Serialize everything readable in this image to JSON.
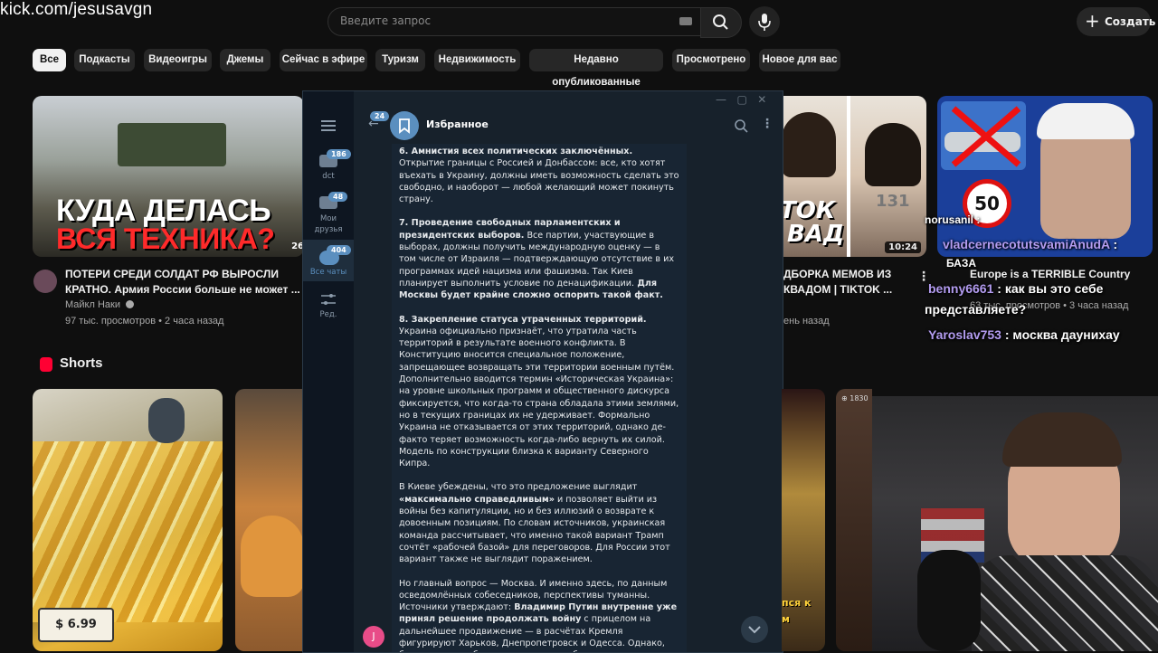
{
  "watermark": "kick.com/jesusavgn",
  "search": {
    "placeholder": "Введите запрос"
  },
  "header": {
    "create_label": "Создать",
    "plus": "+"
  },
  "chips": [
    "Все",
    "Подкасты",
    "Видеоигры",
    "Джемы",
    "Сейчас в эфире",
    "Туризм",
    "Недвижимость",
    "Недавно опубликованные",
    "Просмотрено",
    "Новое для вас"
  ],
  "video1": {
    "thumb_line1": "КУДА ДЕЛАСЬ",
    "thumb_line2": "ВСЯ ТЕХНИКА?",
    "duration": "26",
    "title_line1": "ПОТЕРИ СРЕДИ СОЛДАТ РФ ВЫРОСЛИ",
    "title_line2": "КРАТНО. Армия России больше не может ...",
    "channel": "Майкл Наки",
    "stats": "97 тыс. просмотров • 2 часа назад"
  },
  "video2": {
    "thumb_text1": "ТОК",
    "thumb_text2": "ВАД",
    "thumb_num": "131",
    "duration": "10:24",
    "title_line1": "ДБОРКА МЕМОВ ИЗ",
    "title_line2": "КВАДОМ | TIKTOK ...",
    "stats": "ень назад"
  },
  "video3": {
    "speed_sign": "50",
    "title": "Europe is a TERRIBLE Country",
    "stats": "63 тыс. просмотров • 3 часа назад"
  },
  "shorts": {
    "title": "Shorts",
    "price": "$ 6.99",
    "thumb_caption1": "пся к",
    "thumb_caption2": "м",
    "thumb_stamp": "⊕ 1830"
  },
  "telegram": {
    "chat_title": "Избранное",
    "back_badge": "24",
    "folders": [
      {
        "label": "dct",
        "badge": "186"
      },
      {
        "label_line1": "Мои",
        "label_line2": "друзья",
        "badge": "48"
      },
      {
        "label": "Все чаты",
        "badge": "404"
      },
      {
        "label": "Ред."
      }
    ],
    "avatar_letter": "J",
    "paragraphs": [
      {
        "bold": "6. Амнистия всех политических заключённых.",
        "text": " Открытие границы с Россией и Донбассом: все, кто хотят въехать в Украину, должны иметь возможность сделать это свободно, и наоборот — любой желающий может покинуть страну."
      },
      {
        "bold": "7. Проведение свободных парламентских и президентских выборов.",
        "text": " Все партии, участвующие в выборах, должны получить международную оценку — в том числе от Израиля — подтверждающую отсутствие в их программах идей нацизма или фашизма. Так Киев планирует выполнить условие по денацификации.",
        "bold2": " Для Москвы будет крайне сложно оспорить такой факт."
      },
      {
        "bold": "8. Закрепление статуса утраченных территорий.",
        "text": " Украина официально признаёт, что утратила часть территорий в результате военного конфликта. В Конституцию вносится специальное положение, запрещающее возвращать эти территории военным путём. Дополнительно вводится термин «Историческая Украина»: на уровне школьных программ и общественного дискурса фиксируется, что когда-то страна обладала этими землями, но в текущих границах их не удерживает. Формально Украина не отказывается от этих территорий, однако де-факто теряет возможность когда-либо вернуть их силой. Модель по конструкции близка к варианту Северного Кипра."
      },
      {
        "pre": "В Киеве убеждены, что это предложение выглядит ",
        "bold": "«максимально справедливым»",
        "text": " и позволяет выйти из войны без капитуляции, но и без иллюзий о возврате к довоенным позициям. По словам источников, украинская команда рассчитывает, что именно такой вариант Трамп сочтёт «рабочей базой» для переговоров. Для России этот вариант также не выглядит поражением."
      },
      {
        "pre": "Но главный вопрос — Москва. И именно здесь, по данным осведомлённых собеседников, перспективы туманны. Источники утверждают: ",
        "bold": "Владимир Путин внутренне уже принял решение продолжать войну",
        "text": " с прицелом на дальнейшее продвижение — в расчётах Кремля фигурируют Харьков, Днепропетровск и Одесса. Однако, бюджетные проблемы, сложности мобилизации и рост социального напряжения внутри страны, все же могут изменить позицию"
      }
    ]
  },
  "chat_overlay": [
    {
      "user": "",
      "msg": "norusanil :"
    },
    {
      "user": "vladcernecotutsvamiAnudA",
      "msg": ":"
    },
    {
      "user": "БАЗА",
      "msg": ""
    },
    {
      "user": "benny6661",
      "msg": ": как вы это себе"
    },
    {
      "user": "",
      "msg": "представляете?"
    },
    {
      "user": "Yaroslav753",
      "msg": ": москва дaунихау"
    }
  ]
}
